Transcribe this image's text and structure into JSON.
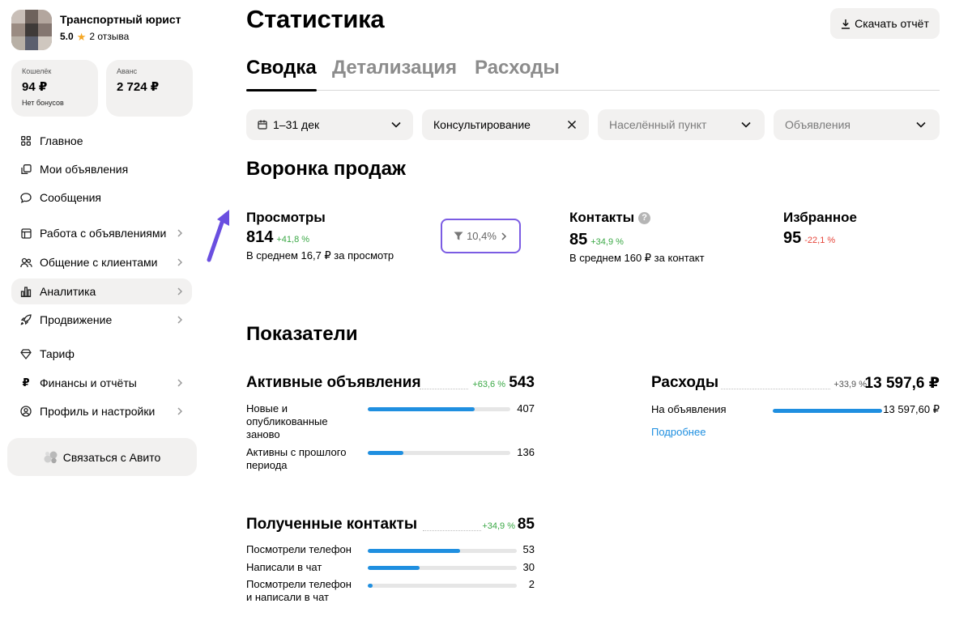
{
  "profile": {
    "name": "Транспортный юрист",
    "rating": "5.0",
    "reviews": "2 отзыва"
  },
  "wallet": {
    "caption": "Кошелёк",
    "value": "94 ₽",
    "note": "Нет бонусов"
  },
  "advance": {
    "caption": "Аванс",
    "value": "2 724 ₽"
  },
  "nav": [
    {
      "label": "Главное",
      "icon": "grid-icon"
    },
    {
      "label": "Мои объявления",
      "icon": "copy-icon"
    },
    {
      "label": "Сообщения",
      "icon": "chat-icon"
    },
    {
      "label": "Работа с объявлениями",
      "icon": "document-icon"
    },
    {
      "label": "Общение с клиентами",
      "icon": "users-icon"
    },
    {
      "label": "Аналитика",
      "icon": "bar-chart-icon"
    },
    {
      "label": "Продвижение",
      "icon": "rocket-icon"
    },
    {
      "label": "Тариф",
      "icon": "diamond-icon"
    },
    {
      "label": "Финансы и отчёты",
      "icon": "ruble-icon"
    },
    {
      "label": "Профиль и настройки",
      "icon": "profile-icon"
    }
  ],
  "contact_avito": "Связаться с Авито",
  "header": {
    "title": "Статистика",
    "download": "Скачать отчёт"
  },
  "tabs": [
    "Сводка",
    "Детализация",
    "Расходы"
  ],
  "filters": {
    "period": "1–31 дек",
    "category": "Консультирование",
    "city_placeholder": "Населённый пункт",
    "ads_placeholder": "Объявления"
  },
  "funnel": {
    "title": "Воронка продаж",
    "views": {
      "label": "Просмотры",
      "value": "814",
      "delta": "+41,8 %",
      "sub": "В среднем 16,7 ₽ за просмотр"
    },
    "conversion": "10,4%",
    "contacts": {
      "label": "Контакты",
      "value": "85",
      "delta": "+34,9 %",
      "sub": "В среднем 160 ₽ за контакт"
    },
    "favorites": {
      "label": "Избранное",
      "value": "95",
      "delta": "-22,1 %"
    }
  },
  "indicators": {
    "title": "Показатели",
    "active_ads": {
      "title": "Активные объявления",
      "delta": "+63,6 %",
      "total": "543",
      "rows": [
        {
          "label": "Новые и опубликованные заново",
          "value": "407",
          "fraction": 0.75
        },
        {
          "label": "Активны с прошлого периода",
          "value": "136",
          "fraction": 0.25
        }
      ]
    },
    "expenses": {
      "title": "Расходы",
      "delta": "+33,9 %",
      "total": "13 597,6 ₽",
      "rows": [
        {
          "label": "На объявления",
          "value": "13 597,60 ₽",
          "fraction": 1.0
        }
      ],
      "more": "Подробнее"
    },
    "contacts_received": {
      "title": "Полученные контакты",
      "delta": "+34,9 %",
      "total": "85",
      "rows": [
        {
          "label": "Посмотрели телефон",
          "value": "53",
          "fraction": 0.62
        },
        {
          "label": "Написали в чат",
          "value": "30",
          "fraction": 0.35
        },
        {
          "label": "Посмотрели телефон и написали в чат",
          "value": "2",
          "fraction": 0.03
        }
      ]
    }
  },
  "colors": {
    "accent_blue": "#1f8fe0",
    "positive": "#3aa845",
    "negative": "#e6453a",
    "highlight": "#7b5ce3",
    "annotation_arrow": "#6a4fe0"
  }
}
